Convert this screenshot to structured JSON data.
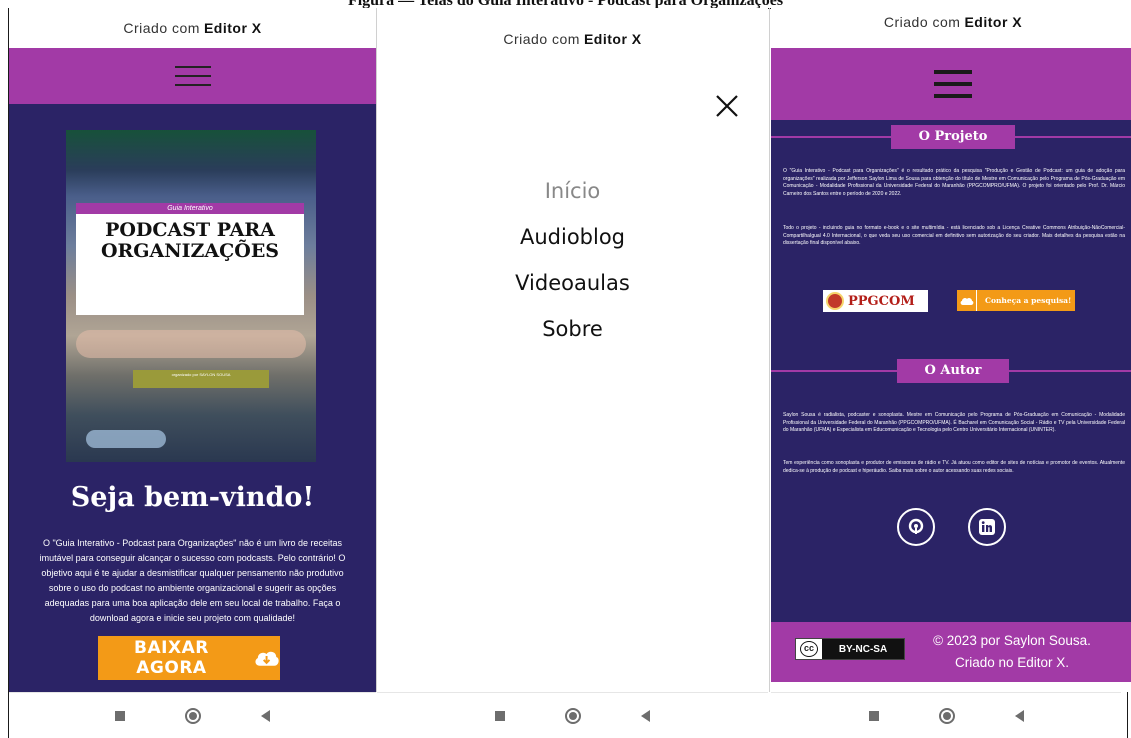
{
  "figure_caption": "Figura — Telas do Guia Interativo - Podcast para Organizações",
  "statusbar": {
    "prefix": "Criado com",
    "brand": "Editor X"
  },
  "home": {
    "cover": {
      "ribbon": "Guia Interativo",
      "title": "PODCAST PARA ORGANIZAÇÕES",
      "author": "organizado por SAYLON SOUSA"
    },
    "welcome": "Seja bem-vindo!",
    "intro": "O \"Guia Interativo - Podcast para Organizações\" não é um livro de receitas imutável para conseguir alcançar o sucesso com podcasts. Pelo contrário! O objetivo aqui é te ajudar a desmistificar qualquer pensamento não produtivo sobre o uso do podcast no ambiente organizacional e sugerir as opções adequadas para uma boa aplicação dele em seu local de trabalho. Faça o download agora e inicie seu projeto com qualidade!",
    "download_label": "BAIXAR AGORA"
  },
  "menu": {
    "items": [
      {
        "label": "Início"
      },
      {
        "label": "Audioblog"
      },
      {
        "label": "Videoaulas"
      },
      {
        "label": "Sobre"
      }
    ]
  },
  "about": {
    "project_heading": "O Projeto",
    "project_p1": "O \"Guia Interativo - Podcast para Organizações\" é o resultado prático da pesquisa \"Produção e Gestão de Podcast: um guia de adoção para organizações\" realizada por Jefferson Saylon Lima de Sousa para obtenção do título de Mestre em Comunicação pelo Programa de Pós-Graduação em Comunicação - Modalidade Profissional da Universidade Federal do Maranhão (PPGCOMPRO/UFMA). O projeto foi orientado pelo Prof. Dr. Márcio Carneiro dos Santos entre o período de 2020 e 2022.",
    "project_p2": "Todo o projeto - incluindo guia no formato e-book e o site multimídia - está licenciado sob a Licença Creative Commons Atribuição-NãoComercial-CompartilhaIgual 4.0 Internacional, o que veda seu uso comercial em definitivo sem autorização do seu criador. Mais detalhes da pesquisa estão na dissertação final disponível abaixo.",
    "ppgcom_logo": "PPGCOM",
    "research_label": "Conheça a pesquisa!",
    "author_heading": "O Autor",
    "author_p1": "Saylon Sousa é radialista, podcaster e sonoplasta. Mestre em Comunicação pelo Programa de Pós-Graduação em Comunicação - Modalidade Profissional da Universidade Federal do Maranhão (PPGCOMPRO/UFMA). É Bacharel em Comunicação Social - Rádio e TV pela Universidade Federal do Maranhão (UFMA) e Especialista em Educomunicação e Tecnologia pelo Centro Universitário Internacional (UNINTER).",
    "author_p2": "Tem experiência como sonoplasta e produtor de emissoras de rádio e TV. Já atuou como editor de sites de notícias e promotor de eventos. Atualmente dedica-se à produção de podcast e hiperáudio. Saiba mais sobre o autor acessando suas redes sociais.",
    "cc_symbol": "cc",
    "cc_label": "BY-NC-SA",
    "footer_line1": "© 2023 por Saylon Sousa.",
    "footer_line2": "Criado no Editor X."
  },
  "colors": {
    "purple": "#a23aa6",
    "navy": "#2b2366",
    "orange": "#f39a17"
  }
}
